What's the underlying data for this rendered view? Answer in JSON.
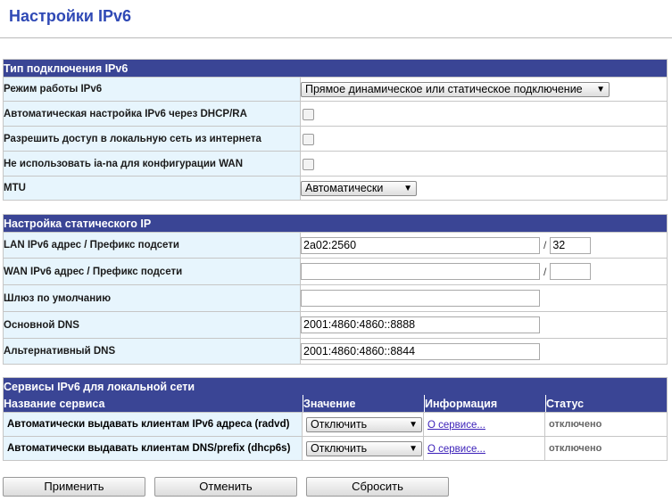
{
  "page_title": "Настройки IPv6",
  "connection": {
    "header": "Тип подключения IPv6",
    "mode_label": "Режим работы IPv6",
    "mode_value": "Прямое динамическое или статическое подключение",
    "auto_dhcp_label": "Автоматическая настройка IPv6 через DHCP/RA",
    "allow_access_label": "Разрешить доступ в локальную сеть из интернета",
    "no_iana_label": "Не использовать ia-na для конфигурации WAN",
    "mtu_label": "MTU",
    "mtu_value": "Автоматически"
  },
  "static_ip": {
    "header": "Настройка статического IP",
    "lan_label": "LAN IPv6 адрес / Префикс подсети",
    "lan_addr": "2a02:2560",
    "lan_prefix": "32",
    "wan_label": "WAN IPv6 адрес / Префикс подсети",
    "wan_addr": "",
    "wan_prefix": "",
    "gateway_label": "Шлюз по умолчанию",
    "gateway_value": "",
    "dns1_label": "Основной DNS",
    "dns1_value": "2001:4860:4860::8888",
    "dns2_label": "Альтернативный DNS",
    "dns2_value": "2001:4860:4860::8844",
    "separator": "/"
  },
  "services": {
    "header": "Сервисы IPv6 для локальной сети",
    "columns": [
      "Название сервиса",
      "Значение",
      "Информация",
      "Статус"
    ],
    "rows": [
      {
        "name": "Автоматически выдавать клиентам IPv6 адреса (radvd)",
        "value": "Отключить",
        "info": "О сервисе...",
        "status": "отключено"
      },
      {
        "name": "Автоматически выдавать клиентам DNS/prefix (dhcp6s)",
        "value": "Отключить",
        "info": "О сервисе...",
        "status": "отключено"
      }
    ]
  },
  "buttons": {
    "apply": "Применить",
    "cancel": "Отменить",
    "reset": "Сбросить"
  }
}
